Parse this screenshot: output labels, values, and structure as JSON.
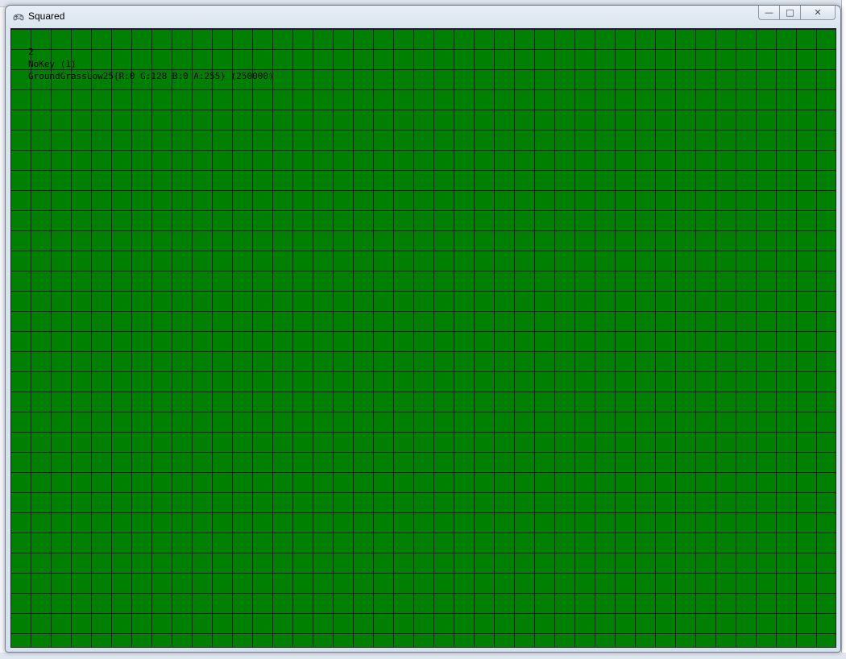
{
  "window": {
    "title": "Squared",
    "icon": "game-controller-icon",
    "buttons": {
      "minimize": "—",
      "maximize": "□",
      "close": "✕"
    }
  },
  "debug": {
    "line1": "2",
    "line2": "NoKey (1)",
    "line3": "GroundGrassLow25{R:0 G:128 B:0 A:255} (250000)"
  },
  "colors": {
    "ground": "#008000",
    "grid_lines": "#1b1b2a"
  }
}
